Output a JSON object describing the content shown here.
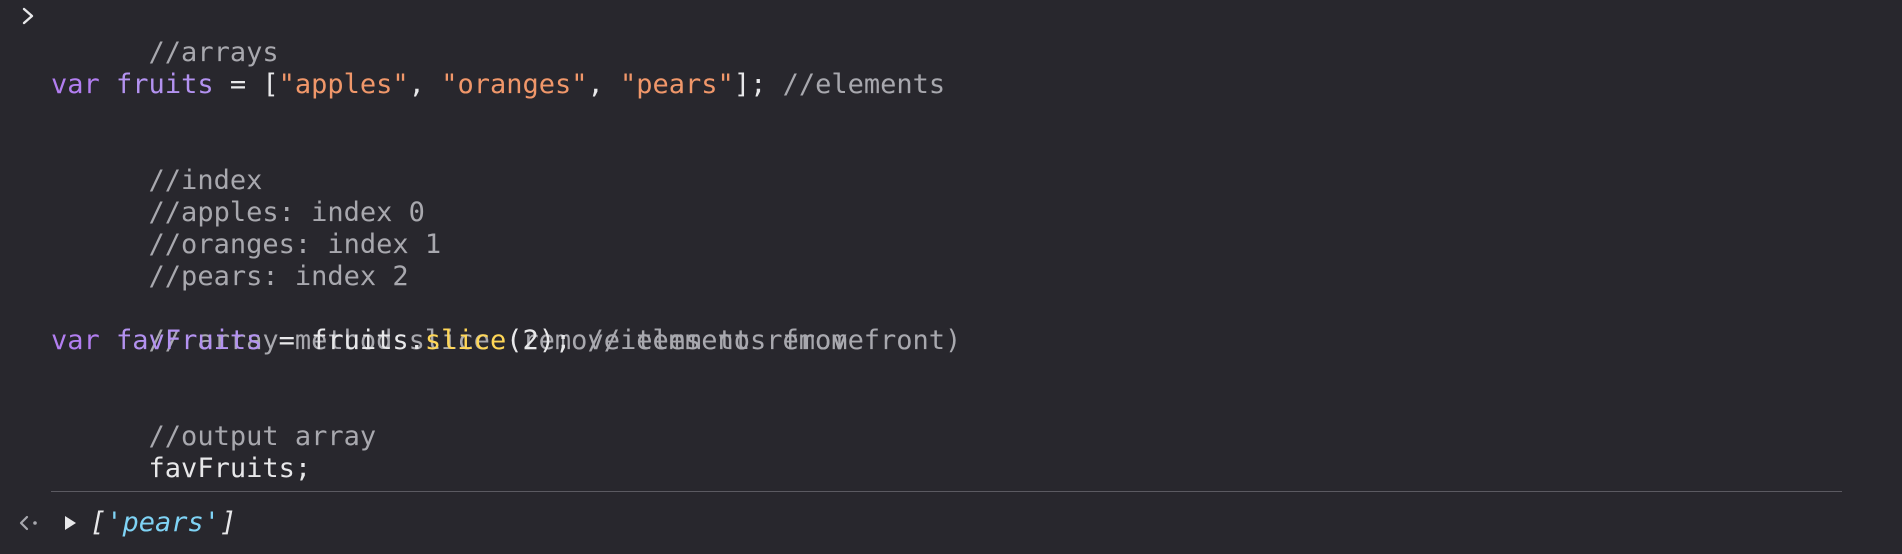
{
  "code": {
    "l1": "//arrays",
    "l3": {
      "kw": "var",
      "name": "fruits",
      "eq": " = [",
      "s1": "\"apples\"",
      "c1": ", ",
      "s2": "\"oranges\"",
      "c2": ", ",
      "s3": "\"pears\"",
      "end": "]; ",
      "comment": "//elements"
    },
    "l5": "//index",
    "l6": "//apples: index 0",
    "l7": "//oranges: index 1",
    "l8": "//pears: index 2",
    "l10": "// array method slice (remove elements from front)",
    "l11": {
      "kw": "var",
      "name": "favFruits",
      "eq": " = fruits.",
      "fn": "slice",
      "args": "(2); ",
      "comment": "//items to remove"
    },
    "l13": "//output array",
    "l14": "favFruits;"
  },
  "result": {
    "open": "[",
    "value": "'pears'",
    "close": "]"
  },
  "colors": {
    "background": "#28272d",
    "keyword": "#b27ef0",
    "identifier": "#b392f0",
    "string": "#f0976a",
    "comment": "#a8a8ae",
    "function": "#ffd757",
    "result_string": "#7fd3f5"
  },
  "icons": {
    "prompt": "chevron-right-icon",
    "result": "return-arrow-icon",
    "expand": "triangle-right-icon"
  }
}
